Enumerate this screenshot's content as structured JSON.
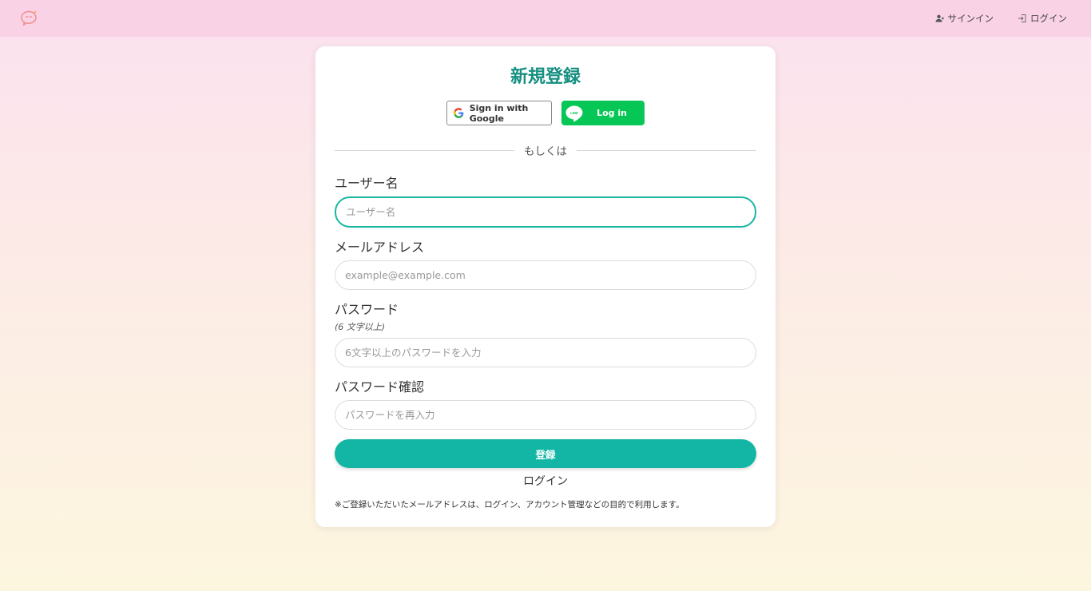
{
  "header": {
    "signin_label": "サインイン",
    "login_label": "ログイン"
  },
  "form": {
    "title": "新規登録",
    "google_label": "Sign in with Google",
    "line_label": "Log in",
    "line_icon_text": "LINE",
    "divider_text": "もしくは",
    "username": {
      "label": "ユーザー名",
      "placeholder": "ユーザー名",
      "value": ""
    },
    "email": {
      "label": "メールアドレス",
      "placeholder": "example@example.com",
      "value": ""
    },
    "password": {
      "label": "パスワード",
      "hint": "(6 文字以上)",
      "placeholder": "6文字以上のパスワードを入力",
      "value": ""
    },
    "password_confirm": {
      "label": "パスワード確認",
      "placeholder": "パスワードを再入力",
      "value": ""
    },
    "submit_label": "登録",
    "login_link": "ログイン",
    "note": "※ご登録いただいたメールアドレスは、ログイン、アカウント管理などの目的で利用します。"
  },
  "colors": {
    "accent": "#13b6a4",
    "title": "#148f80",
    "header_bg": "#f9d2e6",
    "line_green": "#06c755"
  }
}
